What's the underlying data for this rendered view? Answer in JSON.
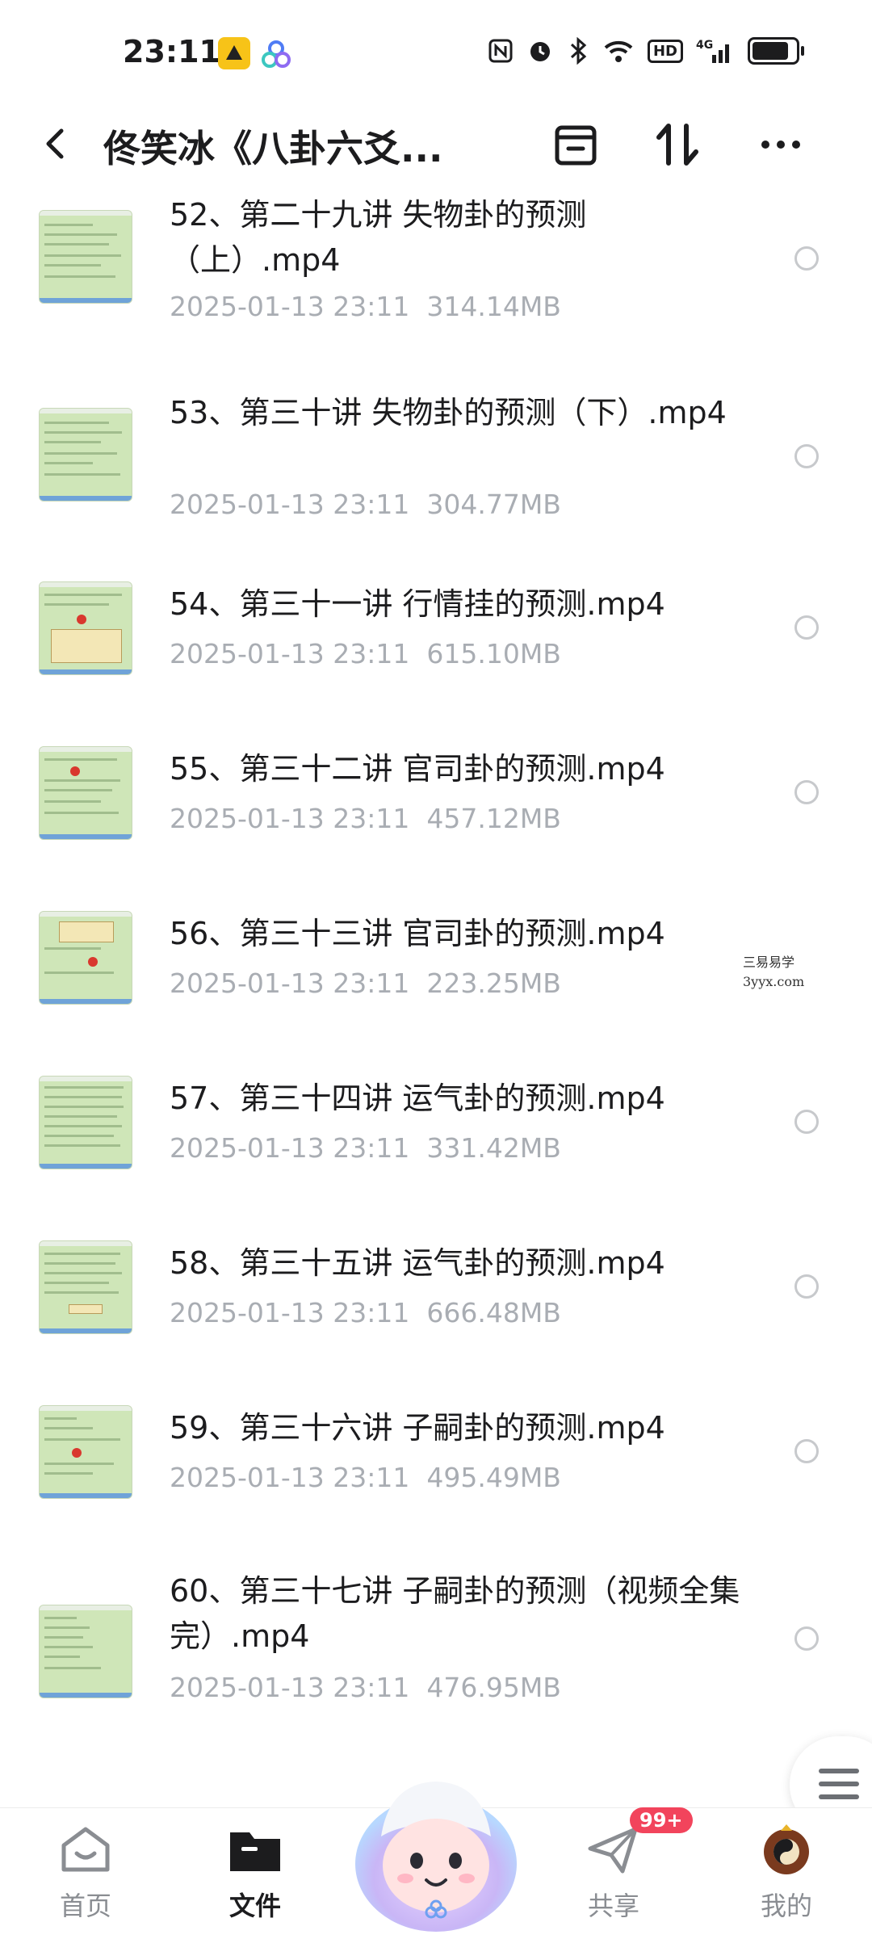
{
  "status_bar": {
    "time": "23:11",
    "icons": [
      "nfc-icon",
      "alarm-icon",
      "bluetooth-icon",
      "wifi-icon",
      "hd-icon",
      "signal-4g-icon",
      "battery-icon"
    ],
    "hd": "HD",
    "net": "4G",
    "battery_level": 0.85
  },
  "header": {
    "title": "佟笑冰《八卦六爻...",
    "actions": [
      "archive-icon",
      "sort-icon",
      "more-icon"
    ]
  },
  "files": [
    {
      "name": "52、第二十九讲 失物卦的预测（上）.mp4",
      "date": "2025-01-13  23:11",
      "size": "314.14MB"
    },
    {
      "name": "53、第三十讲 失物卦的预测（下）.mp4",
      "date": "2025-01-13  23:11",
      "size": "304.77MB"
    },
    {
      "name": "54、第三十一讲 行情挂的预测.mp4",
      "date": "2025-01-13  23:11",
      "size": "615.10MB"
    },
    {
      "name": "55、第三十二讲 官司卦的预测.mp4",
      "date": "2025-01-13  23:11",
      "size": "457.12MB"
    },
    {
      "name": "56、第三十三讲 官司卦的预测.mp4",
      "date": "2025-01-13  23:11",
      "size": "223.25MB"
    },
    {
      "name": "57、第三十四讲 运气卦的预测.mp4",
      "date": "2025-01-13  23:11",
      "size": "331.42MB"
    },
    {
      "name": "58、第三十五讲 运气卦的预测.mp4",
      "date": "2025-01-13  23:11",
      "size": "666.48MB"
    },
    {
      "name": "59、第三十六讲 子嗣卦的预测.mp4",
      "date": "2025-01-13  23:11",
      "size": "495.49MB"
    },
    {
      "name": "60、第三十七讲 子嗣卦的预测（视频全集完）.mp4",
      "date": "2025-01-13  23:11",
      "size": "476.95MB"
    }
  ],
  "watermark": {
    "line1": "三易易学",
    "line2": "3yyx.com"
  },
  "nav": {
    "home": "首页",
    "files": "文件",
    "share": "共享",
    "mine": "我的",
    "share_badge": "99+"
  },
  "colors": {
    "accent": "#1c1c1e",
    "badge": "#f2445c",
    "thumb": "#cfe6b8"
  }
}
